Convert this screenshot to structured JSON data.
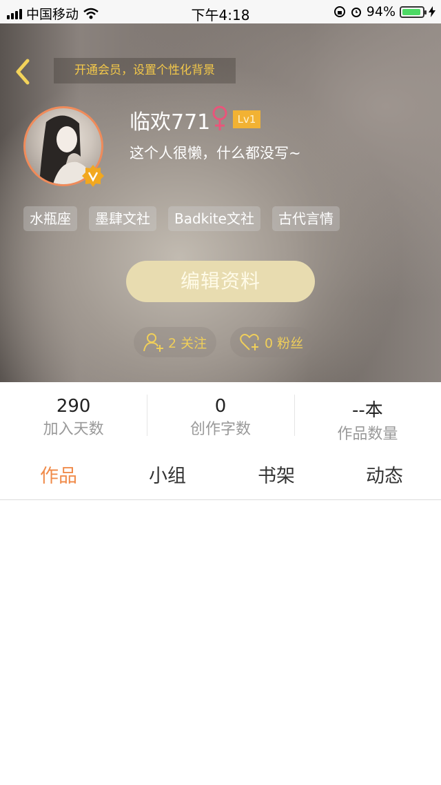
{
  "status_bar": {
    "carrier": "中国移动",
    "time": "下午4:18",
    "battery_percent": "94%",
    "battery_level": 0.94,
    "icons": [
      "signal-icon",
      "wifi-icon",
      "rotation-lock-icon",
      "alarm-icon",
      "battery-icon",
      "charging-icon"
    ]
  },
  "header": {
    "vip_banner": "开通会员，设置个性化背景",
    "username": "临欢771",
    "level": "Lv1",
    "signature": "这个人很懒，什么都没写~",
    "tags": [
      "水瓶座",
      "墨肆文社",
      "Badkite文社",
      "古代言情"
    ],
    "edit_button": "编辑资料",
    "following": "2 关注",
    "followers": "0 粉丝",
    "colors": {
      "accent": "#f3c84a",
      "edit_button": "#e8dcb0",
      "level_badge": "#f2b233"
    }
  },
  "stats": [
    {
      "value": "290",
      "label": "加入天数"
    },
    {
      "value": "0",
      "label": "创作字数"
    },
    {
      "value": "--本",
      "label": "作品数量"
    }
  ],
  "tabs": {
    "items": [
      "作品",
      "小组",
      "书架",
      "动态"
    ],
    "active": "作品",
    "active_color": "#f08b4a"
  }
}
